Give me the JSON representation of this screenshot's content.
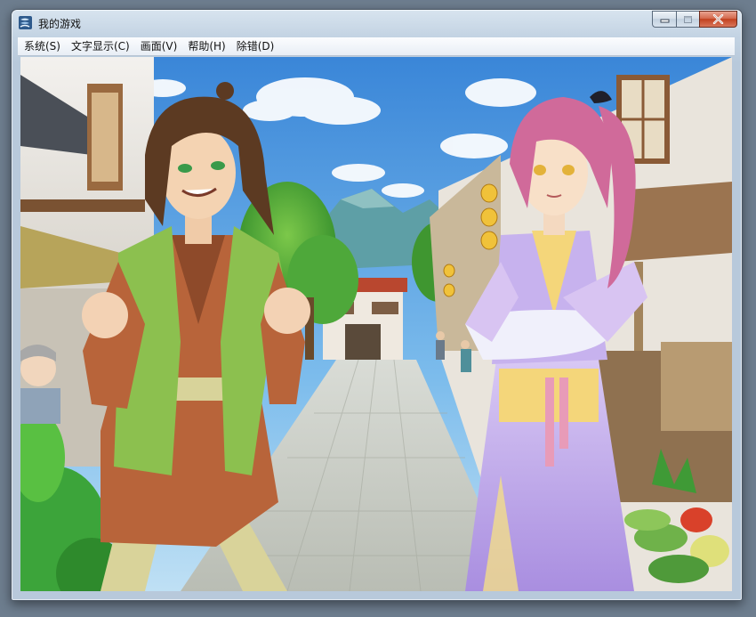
{
  "window": {
    "title": "我的游戏",
    "icon": "rpg-maker-icon"
  },
  "caption_buttons": [
    {
      "name": "minimize",
      "icon": "minimize-icon"
    },
    {
      "name": "maximize",
      "icon": "maximize-icon"
    },
    {
      "name": "close",
      "icon": "close-icon"
    }
  ],
  "menu": [
    {
      "label": "系统(S)"
    },
    {
      "label": "文字显示(C)"
    },
    {
      "label": "画面(V)"
    },
    {
      "label": "帮助(H)"
    },
    {
      "label": "除错(D)"
    }
  ],
  "scene": {
    "setting": "ancient-chinese-street",
    "characters": [
      {
        "name": "brown-haired-man",
        "outfit": "green jacket over brown robe"
      },
      {
        "name": "pink-haired-woman",
        "outfit": "lavender hanfu with yellow sash"
      }
    ]
  },
  "colors": {
    "sky": "#4f9be2",
    "accent_title_close": "#c2411f"
  }
}
